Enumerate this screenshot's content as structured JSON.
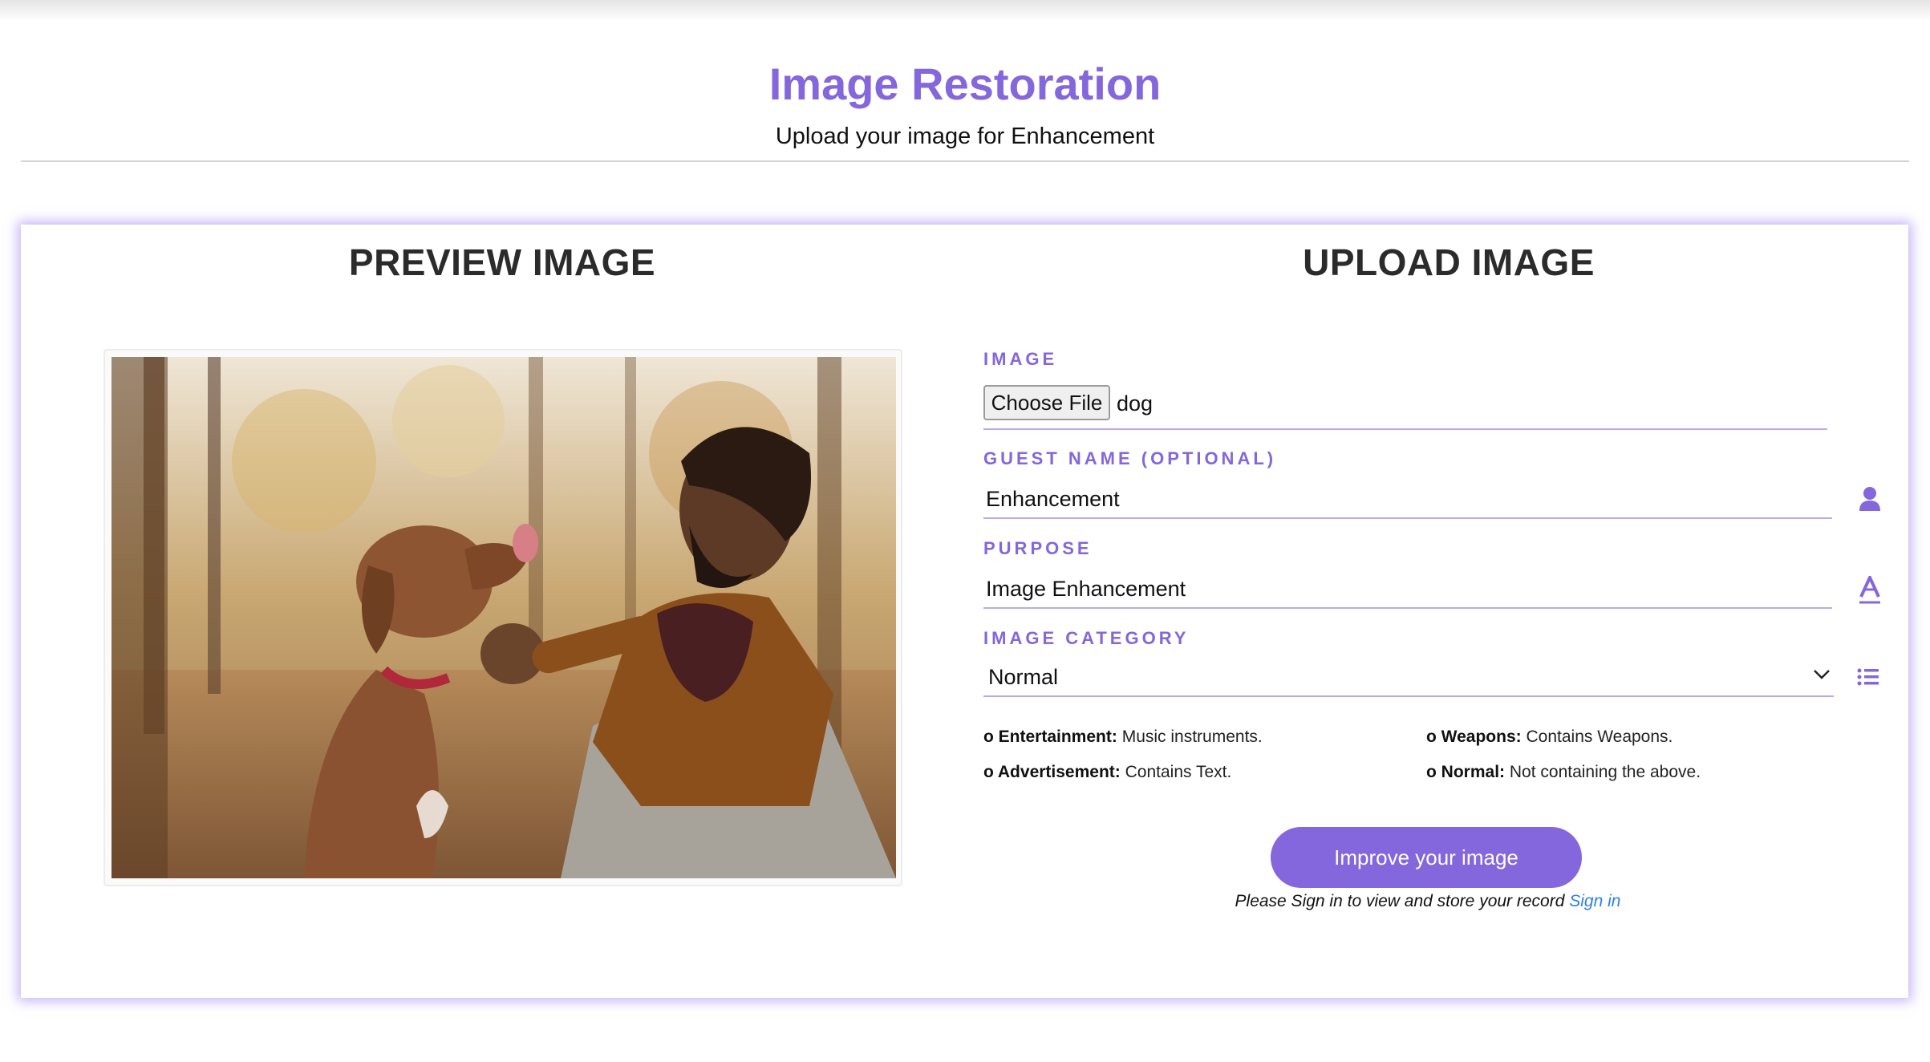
{
  "header": {
    "title": "Image Restoration",
    "subtitle": "Upload your image for Enhancement"
  },
  "preview": {
    "heading": "PREVIEW IMAGE"
  },
  "upload": {
    "heading": "UPLOAD IMAGE",
    "image_field": {
      "label": "IMAGE",
      "button_label": "Choose File",
      "file_name": "dog"
    },
    "guest_name": {
      "label": "GUEST NAME (OPTIONAL)",
      "value": "Enhancement",
      "icon": "user-icon"
    },
    "purpose": {
      "label": "PURPOSE",
      "value": "Image Enhancement",
      "icon": "font-icon"
    },
    "category": {
      "label": "IMAGE CATEGORY",
      "selected": "Normal",
      "icon": "list-icon"
    },
    "category_notes": [
      {
        "bullet": "o",
        "term": "Entertainment:",
        "desc": "Music instruments."
      },
      {
        "bullet": "o",
        "term": "Weapons:",
        "desc": "Contains Weapons."
      },
      {
        "bullet": "o",
        "term": "Advertisement:",
        "desc": "Contains Text."
      },
      {
        "bullet": "o",
        "term": "Normal:",
        "desc": "Not containing the above."
      }
    ],
    "submit_label": "Improve your image",
    "signin_text": "Please Sign in to view and store your record",
    "signin_link": "Sign in"
  },
  "colors": {
    "accent": "#8466dd",
    "underline": "#b9a8f0",
    "link": "#2d7ff0"
  }
}
